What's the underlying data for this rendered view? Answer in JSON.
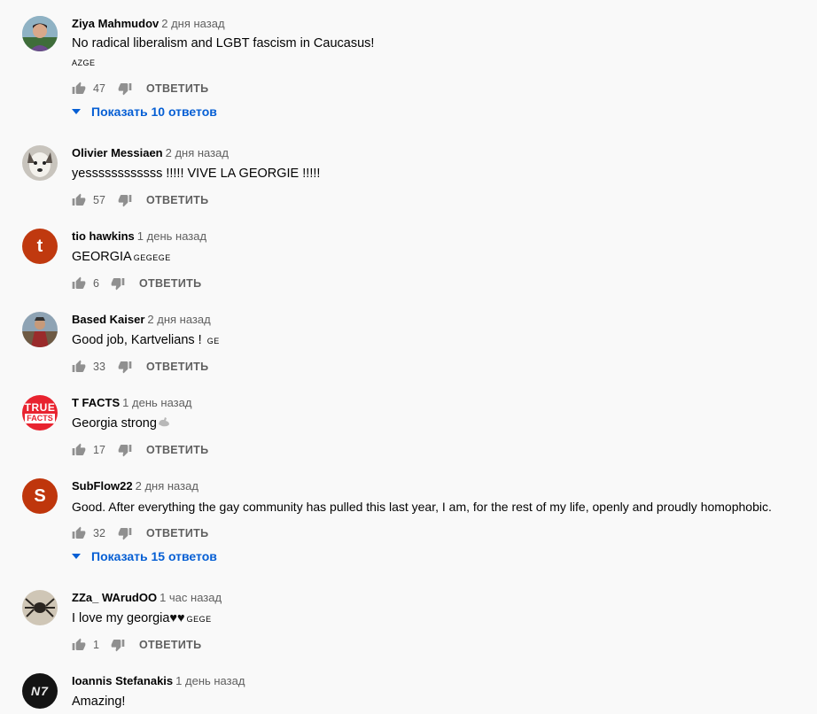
{
  "reply_label": "ОТВЕТИТЬ",
  "comments": [
    {
      "author": "Ziya Mahmudov",
      "time": "2 дня назад",
      "text": "No radical liberalism and LGBT fascism in Caucasus!",
      "flags": "AZGE",
      "likes": "47",
      "replies": "Показать 10 ответов",
      "avatar": "photo-boy"
    },
    {
      "author": "Olivier Messiaen",
      "time": "2 дня назад",
      "text": "yessssssssssss !!!!! VIVE LA GEORGIE !!!!!",
      "likes": "57",
      "avatar": "photo-dog"
    },
    {
      "author": "tio hawkins",
      "time": "1 день назад",
      "text": "GEORGIA",
      "flags": "GEGEGE",
      "likes": "6",
      "avatar": "letter-t",
      "avatar_letter": "t",
      "avatar_color": "#c0390f"
    },
    {
      "author": "Based Kaiser",
      "time": "2 дня назад",
      "text": "Good job, Kartvelians !",
      "flags": "GE",
      "likes": "33",
      "avatar": "photo-painting"
    },
    {
      "author": "T FACTS",
      "time": "1 день назад",
      "text": "Georgia strong",
      "likes": "17",
      "avatar": "logo-true-facts",
      "avatar_logo": [
        "TRUE",
        "FACTS"
      ],
      "avatar_color": "#e8232f",
      "emoji": "flexed-biceps-icon"
    },
    {
      "author": "SubFlow22",
      "time": "2 дня назад",
      "text": "Good.  After everything the gay community has pulled this last year, I am, for the rest of my life, openly and proudly homophobic.",
      "likes": "32",
      "replies": "Показать 15 ответов",
      "avatar": "letter-s",
      "avatar_letter": "S",
      "avatar_color": "#bf360c"
    },
    {
      "author": "ZZa_ WArudOO",
      "time": "1 час назад",
      "text": "I love my georgia",
      "hearts": "♥♥",
      "flags": "GEGE",
      "likes": "1",
      "avatar": "photo-spider"
    },
    {
      "author": "Ioannis Stefanakis",
      "time": "1 день назад",
      "text": "Amazing!",
      "avatar": "logo-n7",
      "avatar_logo": [
        "N7"
      ],
      "avatar_color": "#141414"
    }
  ]
}
